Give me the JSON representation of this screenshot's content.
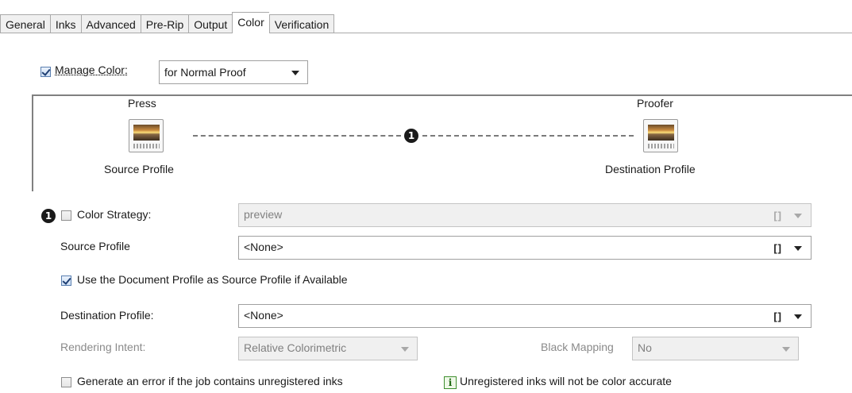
{
  "tabs": [
    "General",
    "Inks",
    "Advanced",
    "Pre-Rip",
    "Output",
    "Color",
    "Verification"
  ],
  "active_tab": "Color",
  "manage_color": {
    "label": "Manage Color:",
    "checked": true,
    "mode": "for Normal Proof"
  },
  "diagram": {
    "source": {
      "title": "Press",
      "caption": "Source Profile",
      "icon": "image-profile-icon"
    },
    "destination": {
      "title": "Proofer",
      "caption": "Destination Profile",
      "icon": "image-profile-icon"
    },
    "badge": "1"
  },
  "color_strategy": {
    "badge": "1",
    "label": "Color Strategy:",
    "checked": false,
    "value": "preview",
    "bracket": "[]"
  },
  "source_profile": {
    "label": "Source Profile",
    "value": "<None>",
    "bracket": "[]"
  },
  "use_document_profile": {
    "label": "Use the Document Profile as Source Profile if Available",
    "checked": true
  },
  "destination_profile": {
    "label": "Destination Profile:",
    "value": "<None>",
    "bracket": "[]"
  },
  "rendering_intent": {
    "label": "Rendering Intent:",
    "value": "Relative Colorimetric"
  },
  "black_mapping": {
    "label": "Black Mapping",
    "value": "No"
  },
  "generate_error": {
    "label": "Generate an error if the job contains unregistered inks",
    "checked": false
  },
  "info_note": {
    "icon": "info-icon",
    "icon_glyph": "i",
    "text": "Unregistered inks will not be color accurate"
  }
}
